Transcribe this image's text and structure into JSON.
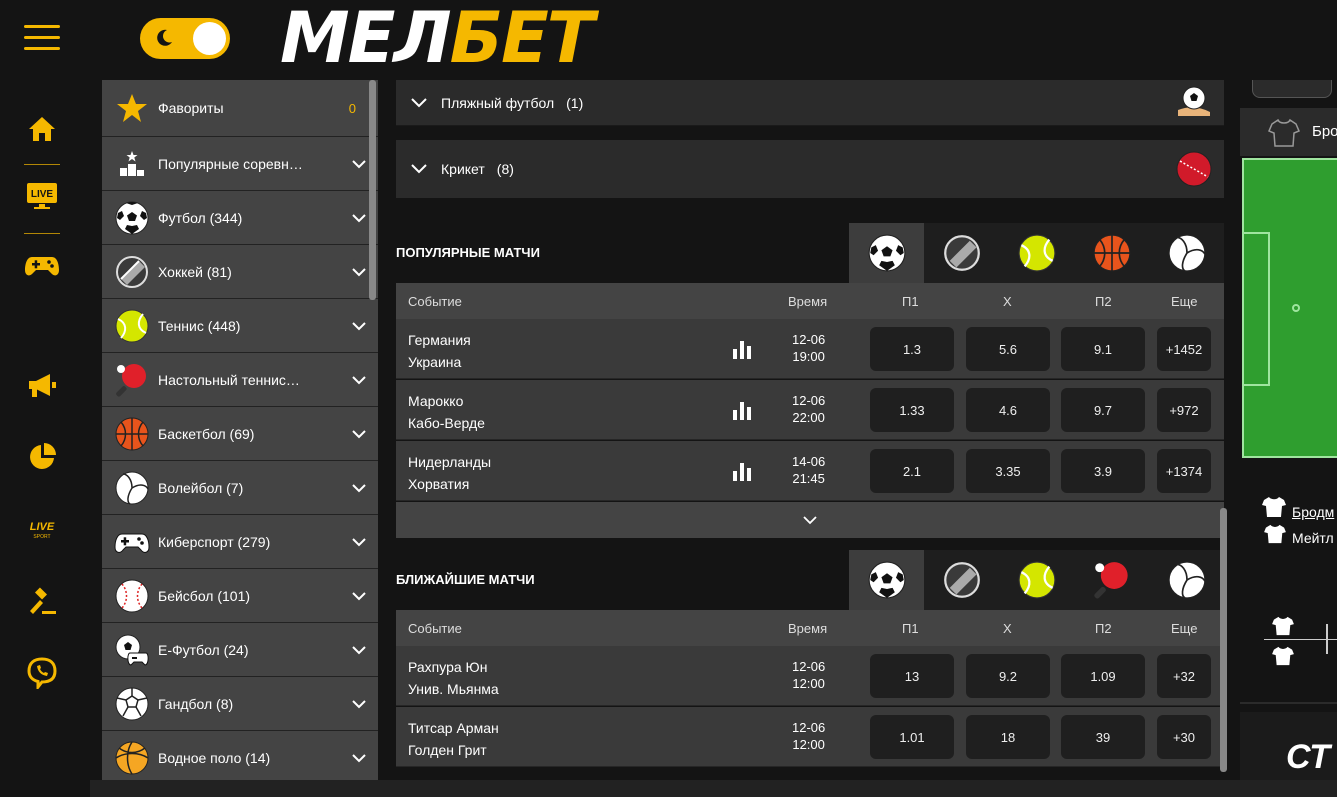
{
  "header": {
    "logo_white": "МЕЛ",
    "logo_yellow": "БЕТ"
  },
  "colors": {
    "accent": "#f5b800",
    "panel": "#3a3a3a",
    "background": "#141414"
  },
  "rail": {
    "icons": [
      "home-icon",
      "live-tv-icon",
      "gamepad-icon",
      "megaphone-icon",
      "pie-chart-icon",
      "live-sport-icon",
      "auction-icon",
      "viber-icon"
    ],
    "live_label": "LIVE",
    "live_sport_label": "LIVE",
    "live_sport_sub": "SPORT"
  },
  "sidebar": {
    "items": [
      {
        "label": "Фавориты",
        "icon": "star-icon",
        "count": "0"
      },
      {
        "label": "Популярные соревн…",
        "icon": "podium-icon"
      },
      {
        "label": "Футбол (344)",
        "icon": "football-icon"
      },
      {
        "label": "Хоккей (81)",
        "icon": "hockey-puck-icon"
      },
      {
        "label": "Теннис (448)",
        "icon": "tennis-ball-icon"
      },
      {
        "label": "Настольный теннис…",
        "icon": "ping-pong-icon"
      },
      {
        "label": "Баскетбол (69)",
        "icon": "basketball-icon"
      },
      {
        "label": "Волейбол (7)",
        "icon": "volleyball-icon"
      },
      {
        "label": "Киберспорт (279)",
        "icon": "gamepad-icon"
      },
      {
        "label": "Бейсбол (101)",
        "icon": "baseball-icon"
      },
      {
        "label": "E-Футбол (24)",
        "icon": "efootball-icon"
      },
      {
        "label": "Гандбол (8)",
        "icon": "handball-icon"
      },
      {
        "label": "Водное поло (14)",
        "icon": "water-polo-icon"
      }
    ]
  },
  "main": {
    "accordions": [
      {
        "title": "Пляжный футбол",
        "count": "(1)"
      },
      {
        "title": "Крикет",
        "count": "(8)"
      }
    ],
    "popular": {
      "title": "ПОПУЛЯРНЫЕ МАТЧИ",
      "tabs": [
        "football-icon",
        "hockey-puck-icon",
        "tennis-ball-icon",
        "basketball-icon",
        "volleyball-icon"
      ],
      "headers": {
        "event": "Событие",
        "time": "Время",
        "p1": "П1",
        "x": "Х",
        "p2": "П2",
        "more": "Еще"
      },
      "rows": [
        {
          "team1": "Германия",
          "team2": "Украина",
          "date": "12-06",
          "time": "19:00",
          "p1": "1.3",
          "x": "5.6",
          "p2": "9.1",
          "more": "+1452"
        },
        {
          "team1": "Марокко",
          "team2": "Кабо-Верде",
          "date": "12-06",
          "time": "22:00",
          "p1": "1.33",
          "x": "4.6",
          "p2": "9.7",
          "more": "+972"
        },
        {
          "team1": "Нидерланды",
          "team2": "Хорватия",
          "date": "14-06",
          "time": "21:45",
          "p1": "2.1",
          "x": "3.35",
          "p2": "3.9",
          "more": "+1374"
        }
      ]
    },
    "upcoming": {
      "title": "БЛИЖАЙШИЕ МАТЧИ",
      "tabs": [
        "football-icon",
        "hockey-puck-icon",
        "tennis-ball-icon",
        "ping-pong-icon",
        "volleyball-icon"
      ],
      "headers": {
        "event": "Событие",
        "time": "Время",
        "p1": "П1",
        "x": "Х",
        "p2": "П2",
        "more": "Еще"
      },
      "rows": [
        {
          "team1": "Рахпура Юн",
          "team2": "Унив. Мьянма",
          "date": "12-06",
          "time": "12:00",
          "p1": "13",
          "x": "9.2",
          "p2": "1.09",
          "more": "+32"
        },
        {
          "team1": "Титсар Арман",
          "team2": "Голден Грит",
          "date": "12-06",
          "time": "12:00",
          "p1": "1.01",
          "x": "18",
          "p2": "39",
          "more": "+30"
        }
      ]
    }
  },
  "right": {
    "team_top": "Бро",
    "team1": "Бродм",
    "team2": "Мейтл",
    "banner": "СТ"
  }
}
